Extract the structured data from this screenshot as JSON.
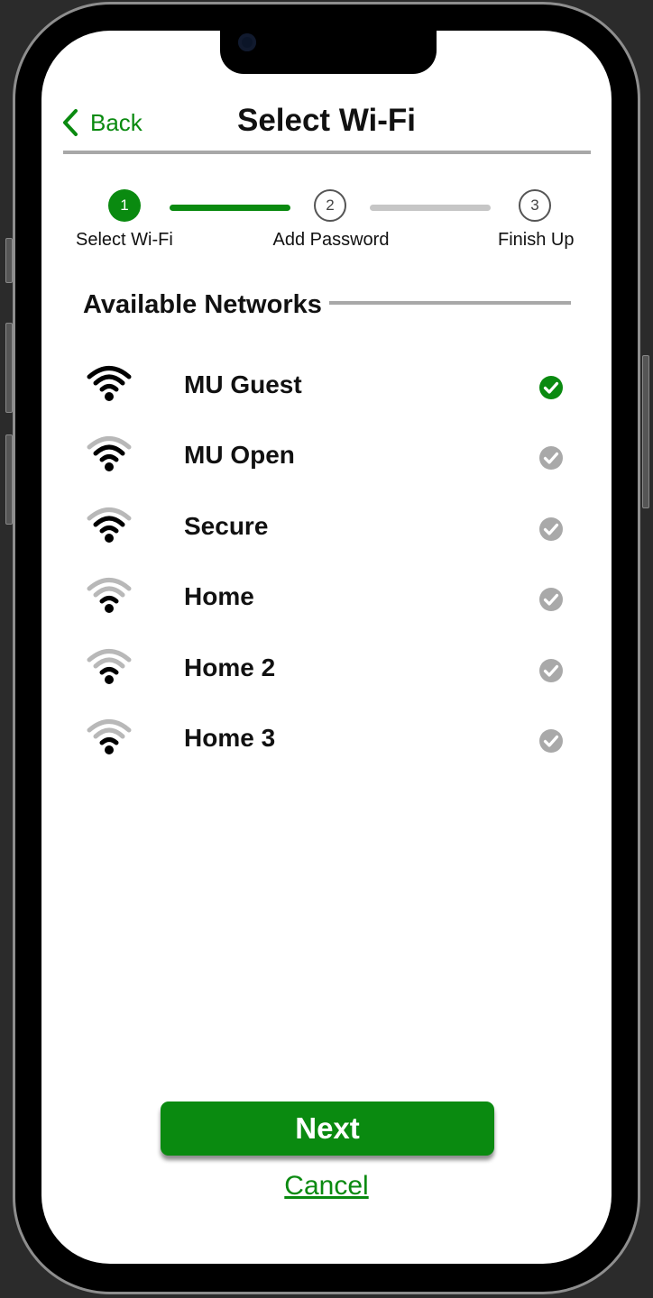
{
  "header": {
    "back_label": "Back",
    "title": "Select Wi-Fi"
  },
  "stepper": {
    "steps": [
      {
        "number": "1",
        "label": "Select Wi-Fi",
        "state": "active"
      },
      {
        "number": "2",
        "label": "Add Password",
        "state": "pending"
      },
      {
        "number": "3",
        "label": "Finish Up",
        "state": "pending"
      }
    ],
    "connectors": [
      "done",
      "todo"
    ]
  },
  "networks": {
    "section_title": "Available Networks",
    "items": [
      {
        "name": "MU Guest",
        "signal_bars": 4,
        "selected": true
      },
      {
        "name": "MU Open",
        "signal_bars": 3,
        "selected": false
      },
      {
        "name": "Secure",
        "signal_bars": 3,
        "selected": false
      },
      {
        "name": "Home",
        "signal_bars": 2,
        "selected": false
      },
      {
        "name": "Home 2",
        "signal_bars": 2,
        "selected": false
      },
      {
        "name": "Home 3",
        "signal_bars": 2,
        "selected": false
      }
    ]
  },
  "actions": {
    "next_label": "Next",
    "cancel_label": "Cancel"
  },
  "colors": {
    "accent": "#0a8a10",
    "unselected_check": "#a9a9a9",
    "weak_signal": "#b8b8b8",
    "divider": "#a8a8a8"
  }
}
